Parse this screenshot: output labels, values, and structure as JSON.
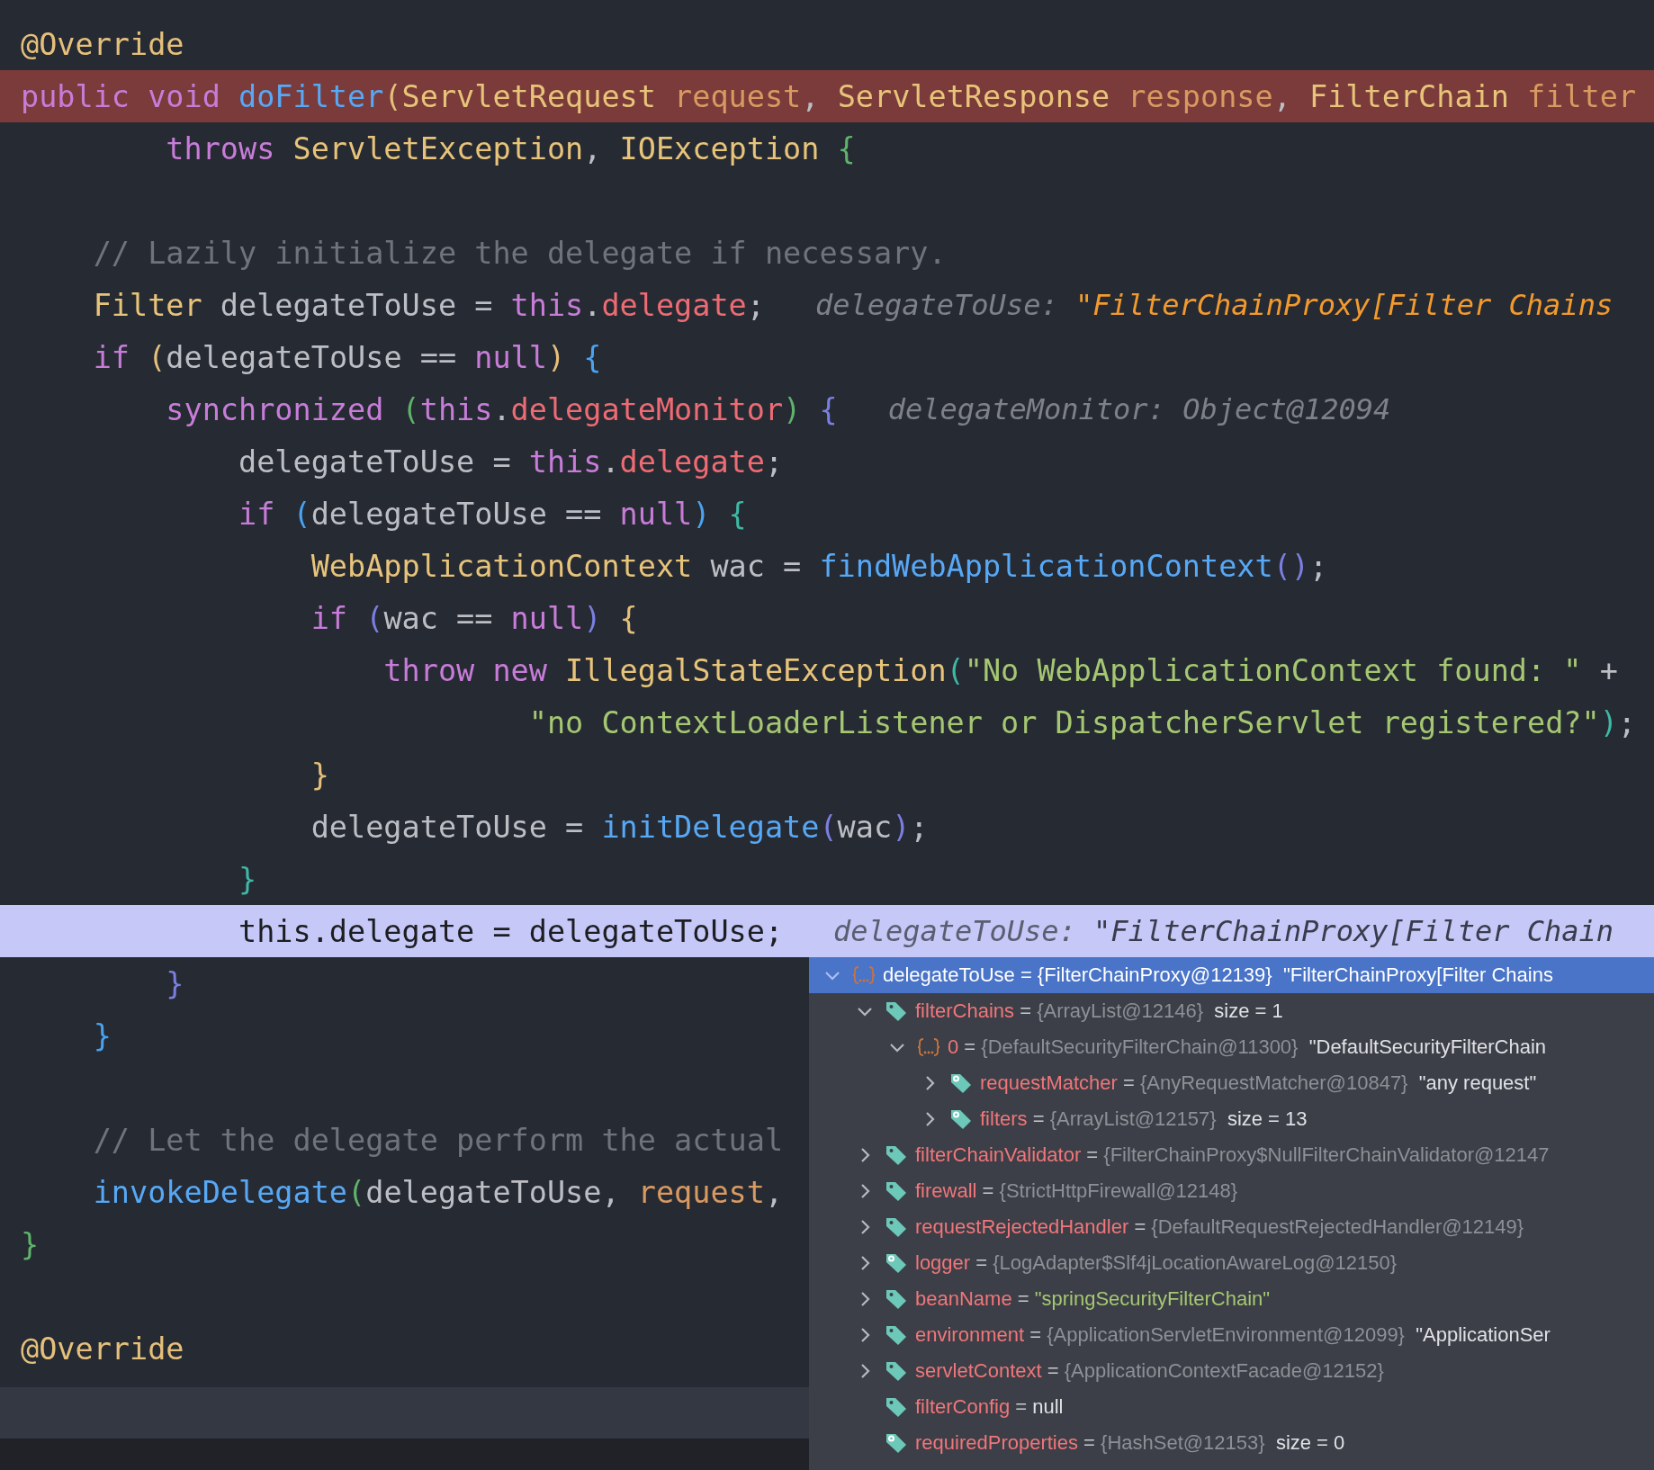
{
  "editor": {
    "lines": [
      {
        "kind": "code",
        "breakpoint": false,
        "execution_point": false,
        "tokens": [
          {
            "text": "@Override",
            "kind": "annot"
          }
        ]
      },
      {
        "kind": "code",
        "breakpoint": true,
        "execution_point": false,
        "tokens": [
          {
            "text": "public void ",
            "kind": "kw"
          },
          {
            "text": "doFilter",
            "kind": "fn"
          },
          {
            "text": "(",
            "kind": "br1"
          },
          {
            "text": "ServletRequest ",
            "kind": "type"
          },
          {
            "text": "request",
            "kind": "param"
          },
          {
            "text": ", ",
            "kind": "plain"
          },
          {
            "text": "ServletResponse ",
            "kind": "type"
          },
          {
            "text": "response",
            "kind": "param"
          },
          {
            "text": ", ",
            "kind": "plain"
          },
          {
            "text": "FilterChain ",
            "kind": "type"
          },
          {
            "text": "filter",
            "kind": "param"
          }
        ]
      },
      {
        "kind": "code",
        "breakpoint": false,
        "execution_point": false,
        "tokens": [
          {
            "text": "        throws ",
            "kind": "kw"
          },
          {
            "text": "ServletException",
            "kind": "type"
          },
          {
            "text": ", ",
            "kind": "plain"
          },
          {
            "text": "IOException ",
            "kind": "type"
          },
          {
            "text": "{",
            "kind": "br3"
          }
        ]
      },
      {
        "kind": "blank",
        "breakpoint": false,
        "execution_point": false
      },
      {
        "kind": "code",
        "breakpoint": false,
        "execution_point": false,
        "tokens": [
          {
            "text": "    // Lazily initialize the delegate if necessary.",
            "kind": "comment"
          }
        ]
      },
      {
        "kind": "code",
        "breakpoint": false,
        "execution_point": false,
        "tokens": [
          {
            "text": "    Filter ",
            "kind": "type"
          },
          {
            "text": "delegateToUse = ",
            "kind": "plain"
          },
          {
            "text": "this",
            "kind": "kw"
          },
          {
            "text": ".",
            "kind": "plain"
          },
          {
            "text": "delegate",
            "kind": "field"
          },
          {
            "text": ";",
            "kind": "plain"
          }
        ],
        "hint": {
          "name": "delegateToUse:",
          "value": {
            "text": "\"FilterChainProxy[Filter Chains",
            "kind": "string"
          }
        }
      },
      {
        "kind": "code",
        "breakpoint": false,
        "execution_point": false,
        "tokens": [
          {
            "text": "    if ",
            "kind": "kw"
          },
          {
            "text": "(",
            "kind": "br1"
          },
          {
            "text": "delegateToUse == ",
            "kind": "plain"
          },
          {
            "text": "null",
            "kind": "kw"
          },
          {
            "text": ") ",
            "kind": "br1"
          },
          {
            "text": "{",
            "kind": "br2"
          }
        ]
      },
      {
        "kind": "code",
        "breakpoint": false,
        "execution_point": false,
        "tokens": [
          {
            "text": "        synchronized ",
            "kind": "kw"
          },
          {
            "text": "(",
            "kind": "br3"
          },
          {
            "text": "this",
            "kind": "kw"
          },
          {
            "text": ".",
            "kind": "plain"
          },
          {
            "text": "delegateMonitor",
            "kind": "field"
          },
          {
            "text": ") ",
            "kind": "br3"
          },
          {
            "text": "{",
            "kind": "br4"
          }
        ],
        "hint": {
          "name": "delegateMonitor:",
          "value": {
            "text": "Object@12094",
            "kind": "ref"
          }
        }
      },
      {
        "kind": "code",
        "breakpoint": false,
        "execution_point": false,
        "tokens": [
          {
            "text": "            delegateToUse = ",
            "kind": "plain"
          },
          {
            "text": "this",
            "kind": "kw"
          },
          {
            "text": ".",
            "kind": "plain"
          },
          {
            "text": "delegate",
            "kind": "field"
          },
          {
            "text": ";",
            "kind": "plain"
          }
        ]
      },
      {
        "kind": "code",
        "breakpoint": false,
        "execution_point": false,
        "tokens": [
          {
            "text": "            if ",
            "kind": "kw"
          },
          {
            "text": "(",
            "kind": "br2"
          },
          {
            "text": "delegateToUse == ",
            "kind": "plain"
          },
          {
            "text": "null",
            "kind": "kw"
          },
          {
            "text": ") ",
            "kind": "br2"
          },
          {
            "text": "{",
            "kind": "br5"
          }
        ]
      },
      {
        "kind": "code",
        "breakpoint": false,
        "execution_point": false,
        "tokens": [
          {
            "text": "                WebApplicationContext ",
            "kind": "type"
          },
          {
            "text": "wac = ",
            "kind": "plain"
          },
          {
            "text": "findWebApplicationContext",
            "kind": "fn"
          },
          {
            "text": "()",
            "kind": "br4"
          },
          {
            "text": ";",
            "kind": "plain"
          }
        ]
      },
      {
        "kind": "code",
        "breakpoint": false,
        "execution_point": false,
        "tokens": [
          {
            "text": "                if ",
            "kind": "kw"
          },
          {
            "text": "(",
            "kind": "br4"
          },
          {
            "text": "wac == ",
            "kind": "plain"
          },
          {
            "text": "null",
            "kind": "kw"
          },
          {
            "text": ") ",
            "kind": "br4"
          },
          {
            "text": "{",
            "kind": "br1"
          }
        ]
      },
      {
        "kind": "code",
        "breakpoint": false,
        "execution_point": false,
        "tokens": [
          {
            "text": "                    throw new ",
            "kind": "kw"
          },
          {
            "text": "IllegalStateException",
            "kind": "type"
          },
          {
            "text": "(",
            "kind": "br5"
          },
          {
            "text": "\"No WebApplicationContext found: \"",
            "kind": "str"
          },
          {
            "text": " +",
            "kind": "plain"
          }
        ]
      },
      {
        "kind": "code",
        "breakpoint": false,
        "execution_point": false,
        "tokens": [
          {
            "text": "                            \"no ContextLoaderListener or DispatcherServlet registered?\"",
            "kind": "str"
          },
          {
            "text": ")",
            "kind": "br5"
          },
          {
            "text": ";",
            "kind": "plain"
          }
        ]
      },
      {
        "kind": "code",
        "breakpoint": false,
        "execution_point": false,
        "tokens": [
          {
            "text": "                }",
            "kind": "br1"
          }
        ]
      },
      {
        "kind": "code",
        "breakpoint": false,
        "execution_point": false,
        "tokens": [
          {
            "text": "                delegateToUse = ",
            "kind": "plain"
          },
          {
            "text": "initDelegate",
            "kind": "fn"
          },
          {
            "text": "(",
            "kind": "br4"
          },
          {
            "text": "wac",
            "kind": "plain"
          },
          {
            "text": ")",
            "kind": "br4"
          },
          {
            "text": ";",
            "kind": "plain"
          }
        ]
      },
      {
        "kind": "code",
        "breakpoint": false,
        "execution_point": false,
        "tokens": [
          {
            "text": "            }",
            "kind": "br5"
          }
        ]
      },
      {
        "kind": "code",
        "breakpoint": false,
        "execution_point": true,
        "tokens": [
          {
            "text": "            this.delegate = delegateToUse;",
            "kind": "plain"
          }
        ],
        "hint": {
          "name": "delegateToUse:",
          "value": {
            "text": "\"FilterChainProxy[Filter Chain",
            "kind": "string"
          }
        }
      },
      {
        "kind": "code",
        "breakpoint": false,
        "execution_point": false,
        "tokens": [
          {
            "text": "        }",
            "kind": "br4"
          }
        ]
      },
      {
        "kind": "code",
        "breakpoint": false,
        "execution_point": false,
        "tokens": [
          {
            "text": "    }",
            "kind": "br2"
          }
        ]
      },
      {
        "kind": "blank",
        "breakpoint": false,
        "execution_point": false
      },
      {
        "kind": "code",
        "breakpoint": false,
        "execution_point": false,
        "tokens": [
          {
            "text": "    // Let the delegate perform the actual",
            "kind": "comment"
          }
        ]
      },
      {
        "kind": "code",
        "breakpoint": false,
        "execution_point": false,
        "tokens": [
          {
            "text": "    invokeDelegate",
            "kind": "fn"
          },
          {
            "text": "(",
            "kind": "br3"
          },
          {
            "text": "delegateToUse, ",
            "kind": "plain"
          },
          {
            "text": "request",
            "kind": "param"
          },
          {
            "text": ",",
            "kind": "plain"
          }
        ]
      },
      {
        "kind": "code",
        "breakpoint": false,
        "execution_point": false,
        "tokens": [
          {
            "text": "}",
            "kind": "br3"
          }
        ]
      },
      {
        "kind": "blank",
        "breakpoint": false,
        "execution_point": false
      },
      {
        "kind": "code",
        "breakpoint": false,
        "execution_point": false,
        "tokens": [
          {
            "text": "@Override",
            "kind": "annot"
          }
        ]
      }
    ]
  },
  "debug_popup": {
    "nodes": [
      {
        "name": "delegateToUse",
        "operator": "=",
        "value": {
          "text": "{FilterChainProxy@12139}",
          "kind": "ref"
        },
        "extra": "\"FilterChainProxy[Filter Chains",
        "kind": "object",
        "expanded": true,
        "selected": true,
        "children": [
          {
            "name": "filterChains",
            "operator": "=",
            "value": {
              "text": "{ArrayList@12146}",
              "kind": "ref"
            },
            "extra": "size = 1",
            "kind": "field",
            "expanded": true,
            "selected": false,
            "children": [
              {
                "name": "0",
                "operator": "=",
                "value": {
                  "text": "{DefaultSecurityFilterChain@11300}",
                  "kind": "ref"
                },
                "extra": "\"DefaultSecurityFilterChain",
                "kind": "object",
                "expanded": true,
                "selected": false,
                "children": [
                  {
                    "name": "requestMatcher",
                    "operator": "=",
                    "value": {
                      "text": "{AnyRequestMatcher@10847}",
                      "kind": "ref"
                    },
                    "extra": "\"any request\"",
                    "kind": "final-field",
                    "expanded": false,
                    "selected": false
                  },
                  {
                    "name": "filters",
                    "operator": "=",
                    "value": {
                      "text": "{ArrayList@12157}",
                      "kind": "ref"
                    },
                    "extra": "size = 13",
                    "kind": "final-field",
                    "expanded": false,
                    "selected": false
                  }
                ]
              }
            ]
          },
          {
            "name": "filterChainValidator",
            "operator": "=",
            "value": {
              "text": "{FilterChainProxy$NullFilterChainValidator@12147",
              "kind": "ref"
            },
            "kind": "field",
            "expanded": false,
            "selected": false
          },
          {
            "name": "firewall",
            "operator": "=",
            "value": {
              "text": "{StrictHttpFirewall@12148}",
              "kind": "ref"
            },
            "kind": "field",
            "expanded": false,
            "selected": false
          },
          {
            "name": "requestRejectedHandler",
            "operator": "=",
            "value": {
              "text": "{DefaultRequestRejectedHandler@12149}",
              "kind": "ref"
            },
            "kind": "field",
            "expanded": false,
            "selected": false
          },
          {
            "name": "logger",
            "operator": "=",
            "value": {
              "text": "{LogAdapter$Slf4jLocationAwareLog@12150}",
              "kind": "ref"
            },
            "kind": "final-field",
            "expanded": false,
            "selected": false
          },
          {
            "name": "beanName",
            "operator": "=",
            "value": {
              "text": "\"springSecurityFilterChain\"",
              "kind": "string"
            },
            "kind": "field",
            "expanded": false,
            "selected": false
          },
          {
            "name": "environment",
            "operator": "=",
            "value": {
              "text": "{ApplicationServletEnvironment@12099}",
              "kind": "ref"
            },
            "extra": "\"ApplicationSer",
            "kind": "field",
            "expanded": false,
            "selected": false
          },
          {
            "name": "servletContext",
            "operator": "=",
            "value": {
              "text": "{ApplicationContextFacade@12152}",
              "kind": "ref"
            },
            "kind": "field",
            "expanded": false,
            "selected": false
          },
          {
            "name": "filterConfig",
            "operator": "=",
            "value": {
              "text": "null",
              "kind": "plain"
            },
            "kind": "field",
            "selected": false
          },
          {
            "name": "requiredProperties",
            "operator": "=",
            "value": {
              "text": "{HashSet@12153}",
              "kind": "ref"
            },
            "extra": "size = 0",
            "kind": "final-field",
            "selected": false
          }
        ]
      }
    ]
  }
}
